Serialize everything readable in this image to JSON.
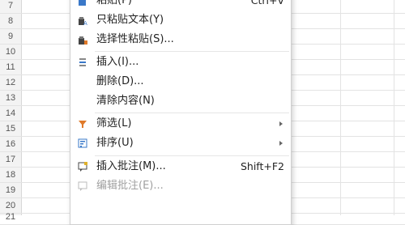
{
  "sheet": {
    "rows": [
      "7",
      "8",
      "9",
      "10",
      "11",
      "12",
      "13",
      "14",
      "15",
      "16",
      "17",
      "18",
      "19",
      "20",
      "21"
    ]
  },
  "menu": {
    "items": [
      {
        "label": "粘贴(P)",
        "shortcut": "Ctrl+V",
        "icon": "paste-icon"
      },
      {
        "label": "只粘贴文本(Y)",
        "icon": "paste-text-icon"
      },
      {
        "label": "选择性粘贴(S)...",
        "icon": "paste-special-icon"
      },
      {
        "label": "插入(I)...",
        "icon": "insert-icon"
      },
      {
        "label": "删除(D)..."
      },
      {
        "label": "清除内容(N)"
      },
      {
        "label": "筛选(L)",
        "icon": "filter-icon",
        "submenu": true
      },
      {
        "label": "排序(U)",
        "icon": "sort-icon",
        "submenu": true
      },
      {
        "label": "插入批注(M)...",
        "shortcut": "Shift+F2",
        "icon": "insert-comment-icon"
      },
      {
        "label": "编辑批注(E)...",
        "icon": "edit-comment-icon",
        "disabled": true
      }
    ]
  }
}
